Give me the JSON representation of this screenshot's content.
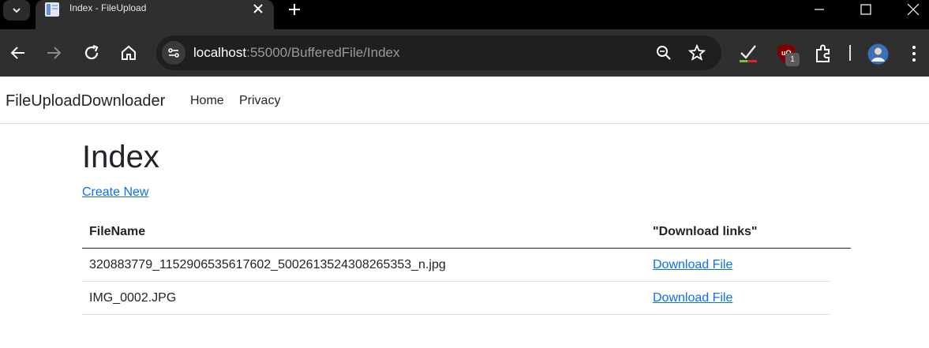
{
  "browser": {
    "tab": {
      "title": "Index - FileUpload"
    },
    "url": {
      "host": "localhost",
      "path": ":55000/BufferedFile/Index"
    },
    "extension_badge": "1",
    "icons": [
      "tab-search-icon",
      "favicon-icon",
      "close-icon",
      "new-tab-icon",
      "minimize-icon",
      "maximize-icon",
      "window-close-icon",
      "back-icon",
      "forward-icon",
      "reload-icon",
      "home-icon",
      "site-info-icon",
      "zoom-icon",
      "bookmark-star-icon",
      "extension-check-icon",
      "ublock-icon",
      "extensions-puzzle-icon",
      "profile-avatar-icon",
      "menu-kebab-icon"
    ]
  },
  "navbar": {
    "brand": "FileUploadDownloader",
    "links": [
      "Home",
      "Privacy"
    ]
  },
  "main": {
    "title": "Index",
    "create_link": "Create New",
    "table": {
      "headers": [
        "FileName",
        "\"Download links\""
      ],
      "rows": [
        {
          "filename": "320883779_1152906535617602_5002613524308265353_n.jpg",
          "link": "Download File"
        },
        {
          "filename": "IMG_0002.JPG",
          "link": "Download File"
        }
      ]
    }
  },
  "colors": {
    "link": "#0d6efd",
    "text": "#212529",
    "chrome_dark": "#2f2f2f"
  }
}
